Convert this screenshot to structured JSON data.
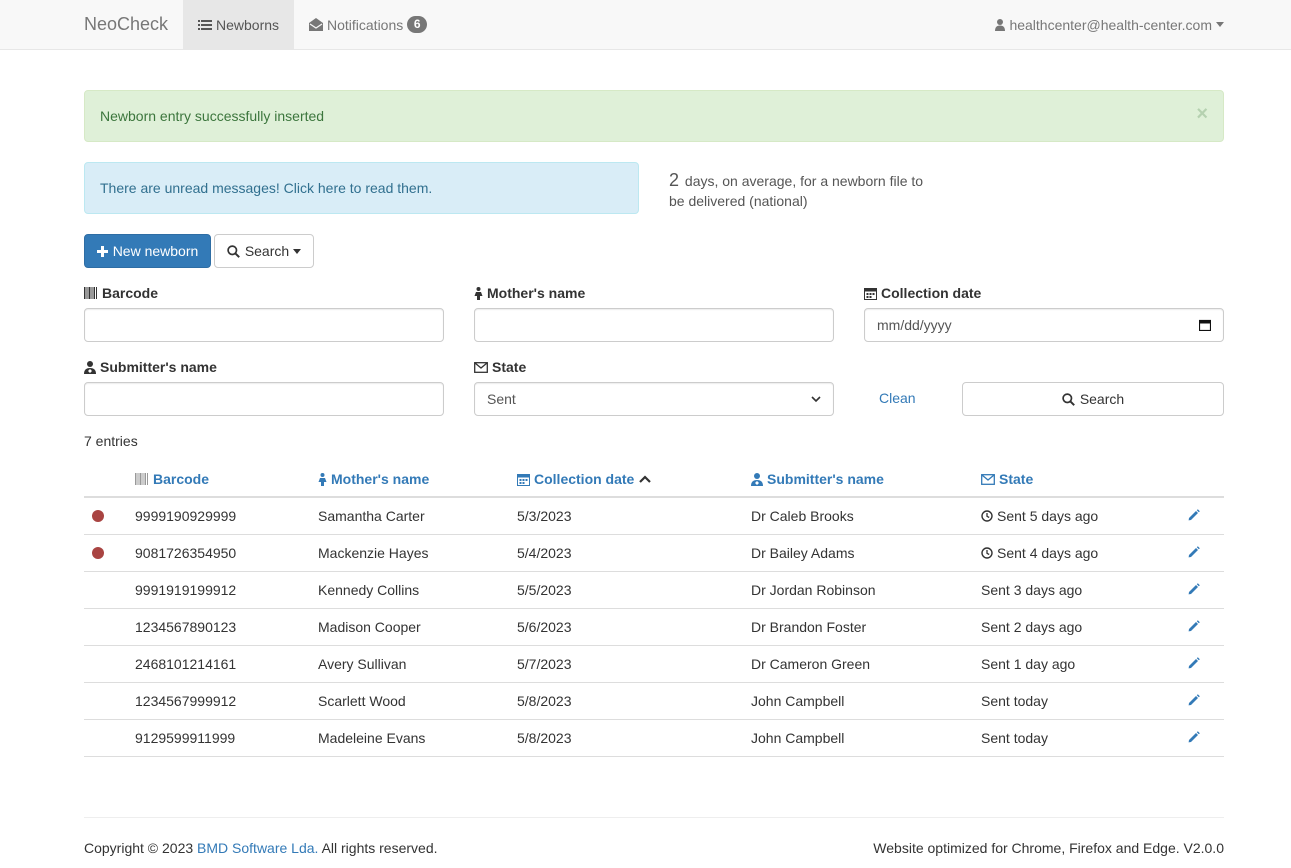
{
  "navbar": {
    "brand": "NeoCheck",
    "newborns_label": "Newborns",
    "notifications_label": "Notifications",
    "notifications_count": "6",
    "user_email": "healthcenter@health-center.com"
  },
  "alerts": {
    "success_text": "Newborn entry successfully inserted",
    "close_glyph": "×",
    "info_text": "There are unread messages! Click here to read them."
  },
  "average": {
    "days": "2",
    "text": "days, on average, for a newborn file to be delivered (national)"
  },
  "actions": {
    "new_newborn_label": "New newborn",
    "search_toggle_label": "Search"
  },
  "filters": {
    "barcode_label": "Barcode",
    "barcode_value": "",
    "mother_label": "Mother's name",
    "mother_value": "",
    "collection_date_label": "Collection date",
    "collection_date_placeholder": "mm/dd/yyyy",
    "submitter_label": "Submitter's name",
    "submitter_value": "",
    "state_label": "State",
    "state_value": "Sent",
    "clean_label": "Clean",
    "search_button_label": "Search"
  },
  "entries_text": "7 entries",
  "table": {
    "headers": {
      "barcode": "Barcode",
      "mother": "Mother's name",
      "collection_date": "Collection date",
      "submitter": "Submitter's name",
      "state": "State"
    },
    "rows": [
      {
        "unread": true,
        "barcode": "9999190929999",
        "mother": "Samantha Carter",
        "date": "5/3/2023",
        "submitter": "Dr Caleb Brooks",
        "state": "Sent 5 days ago",
        "clock": true
      },
      {
        "unread": true,
        "barcode": "9081726354950",
        "mother": "Mackenzie Hayes",
        "date": "5/4/2023",
        "submitter": "Dr Bailey Adams",
        "state": "Sent 4 days ago",
        "clock": true
      },
      {
        "unread": false,
        "barcode": "9991919199912",
        "mother": "Kennedy Collins",
        "date": "5/5/2023",
        "submitter": "Dr Jordan Robinson",
        "state": "Sent 3 days ago",
        "clock": false
      },
      {
        "unread": false,
        "barcode": "1234567890123",
        "mother": "Madison Cooper",
        "date": "5/6/2023",
        "submitter": "Dr Brandon Foster",
        "state": "Sent 2 days ago",
        "clock": false
      },
      {
        "unread": false,
        "barcode": "2468101214161",
        "mother": "Avery Sullivan",
        "date": "5/7/2023",
        "submitter": "Dr Cameron Green",
        "state": "Sent 1 day ago",
        "clock": false
      },
      {
        "unread": false,
        "barcode": "1234567999912",
        "mother": "Scarlett Wood",
        "date": "5/8/2023",
        "submitter": "John Campbell",
        "state": "Sent today",
        "clock": false
      },
      {
        "unread": false,
        "barcode": "9129599911999",
        "mother": "Madeleine Evans",
        "date": "5/8/2023",
        "submitter": "John Campbell",
        "state": "Sent today",
        "clock": false
      }
    ]
  },
  "footer": {
    "copyright_prefix": "Copyright © 2023",
    "company_link": "BMD Software Lda.",
    "copyright_suffix": "All rights reserved.",
    "right_text": "Website optimized for Chrome, Firefox and Edge. V2.0.0"
  },
  "colors": {
    "primary": "#337ab7",
    "unread_dot": "#a94442",
    "success_bg": "#dff0d8",
    "info_bg": "#d9edf7"
  },
  "icons": [
    "list-icon",
    "envelope-open-icon",
    "user-icon",
    "plus-icon",
    "search-icon",
    "barcode-icon",
    "female-icon",
    "calendar-icon",
    "user-md-icon",
    "envelope-icon",
    "clock-icon",
    "pencil-icon",
    "sort-up-icon"
  ]
}
